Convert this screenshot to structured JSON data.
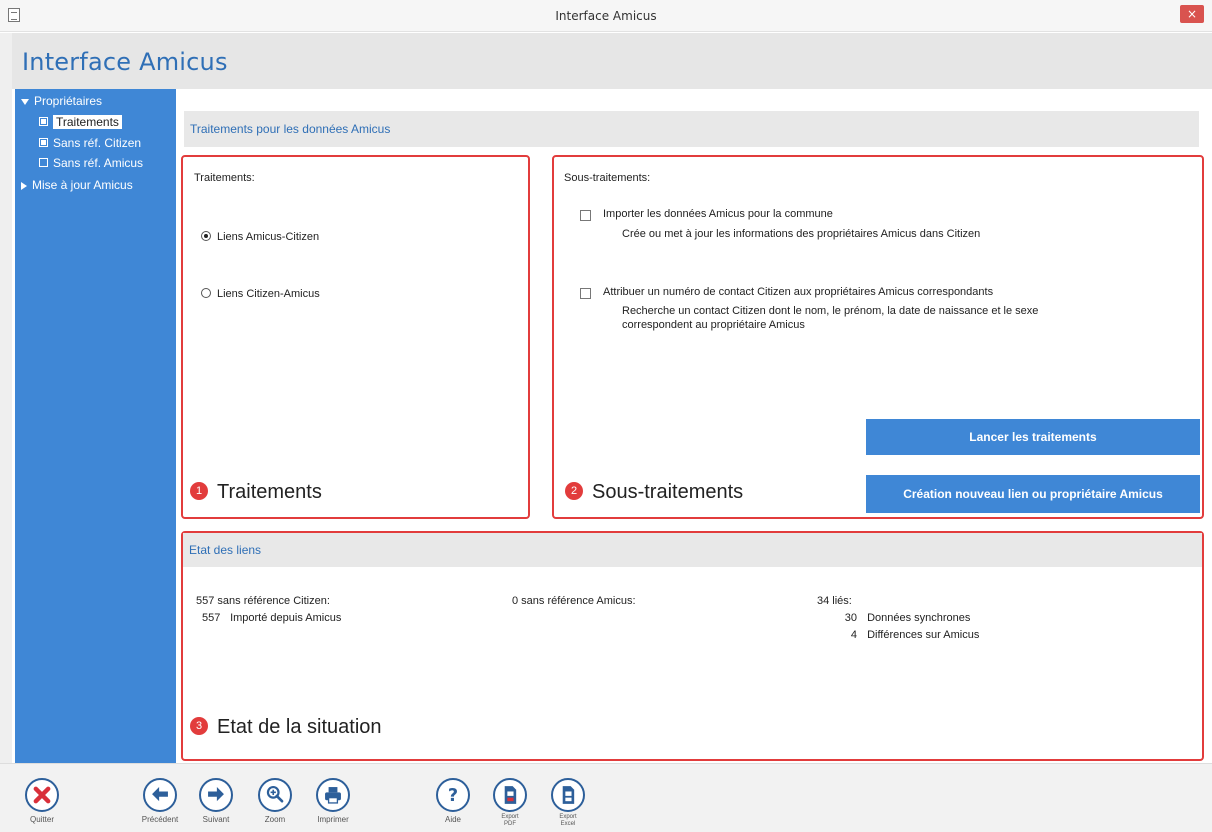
{
  "window": {
    "title": "Interface Amicus",
    "close_glyph": "×"
  },
  "app": {
    "name": "Interface Amicus"
  },
  "sidebar": {
    "groups": [
      {
        "label": "Propriétaires",
        "expanded": true
      },
      {
        "label": "Mise à jour Amicus",
        "expanded": false
      }
    ],
    "items": [
      {
        "label": "Traitements",
        "selected": true,
        "checked": true
      },
      {
        "label": "Sans réf. Citizen",
        "selected": false,
        "checked": true
      },
      {
        "label": "Sans réf. Amicus",
        "selected": false,
        "checked": false
      }
    ]
  },
  "main": {
    "section_title": "Traitements pour les données Amicus",
    "traitements": {
      "label": "Traitements:",
      "options": [
        {
          "label": "Liens Amicus-Citizen",
          "selected": true
        },
        {
          "label": "Liens Citizen-Amicus",
          "selected": false
        }
      ],
      "annotation_number": "1",
      "annotation_text": "Traitements"
    },
    "sous_traitements": {
      "label": "Sous-traitements:",
      "options": [
        {
          "title": "Importer les données Amicus pour la commune",
          "description": "Crée ou met à jour les informations des propriétaires Amicus dans Citizen",
          "checked": false
        },
        {
          "title": "Attribuer un numéro de contact Citizen aux propriétaires Amicus correspondants",
          "description": "Recherche un contact Citizen dont le nom, le prénom, la date de naissance et le sexe correspondent au propriétaire Amicus",
          "checked": false
        }
      ],
      "run_button": "Lancer les traitements",
      "create_button": "Création nouveau lien ou propriétaire Amicus",
      "annotation_number": "2",
      "annotation_text": "Sous-traitements"
    },
    "etat": {
      "title": "Etat des liens",
      "col1": {
        "heading": "557 sans référence Citizen:",
        "rows": [
          {
            "count": "557",
            "label": "Importé depuis Amicus"
          }
        ]
      },
      "col2": {
        "heading": "0 sans référence Amicus:"
      },
      "col3": {
        "heading": "34 liés:",
        "rows": [
          {
            "count": "30",
            "label": "Données synchrones"
          },
          {
            "count": "4",
            "label": "Différences sur Amicus"
          }
        ]
      },
      "annotation_number": "3",
      "annotation_text": "Etat de la situation"
    }
  },
  "toolbar": {
    "quit": "Quitter",
    "previous": "Précédent",
    "next": "Suivant",
    "zoom": "Zoom",
    "print": "Imprimer",
    "help": "Aide",
    "export_pdf_line1": "Export",
    "export_pdf_line2": "PDF",
    "export_excel_line1": "Export",
    "export_excel_line2": "Excel"
  },
  "colors": {
    "accent": "#3f87d6",
    "title_blue": "#2f6fb6",
    "annotation_red": "#e23c3c",
    "quit_red": "#d9303a"
  }
}
